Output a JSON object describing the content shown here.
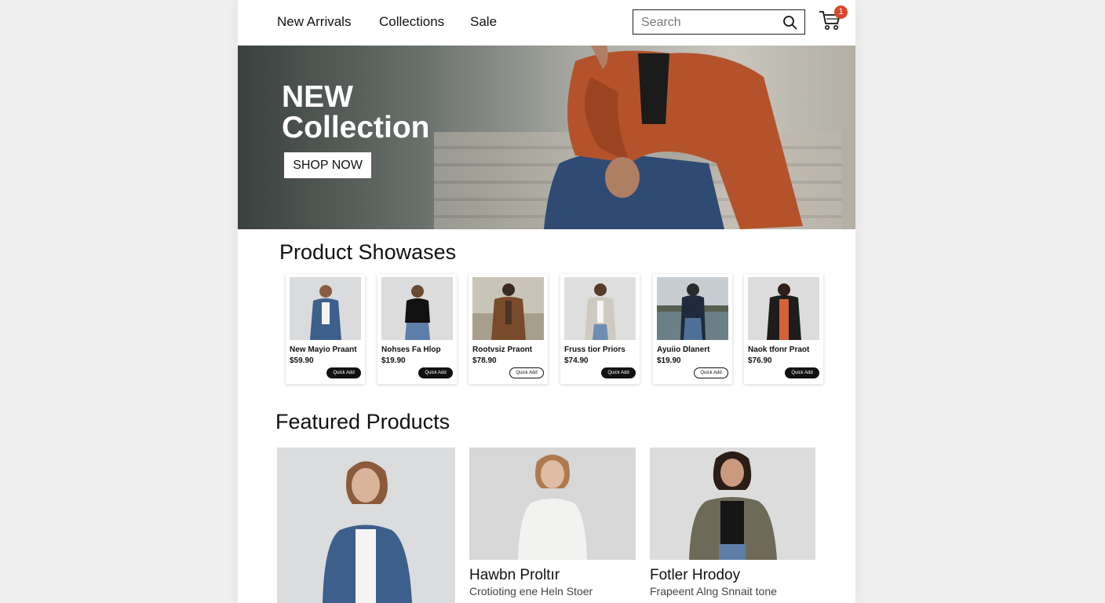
{
  "nav": {
    "links": [
      "New Arrivals",
      "Collections",
      "Sale"
    ],
    "search_placeholder": "Search",
    "cart_count": "1"
  },
  "hero": {
    "title_line1": "NEW",
    "title_line2": "Collection",
    "cta_label": "SHOP NOW"
  },
  "showcase": {
    "title": "Product Showases",
    "products": [
      {
        "name": "New Mayio Praant",
        "price": "$59.90",
        "button": "Quick Add",
        "button_style": "dark"
      },
      {
        "name": "Nohses Fa Hlop",
        "price": "$19.90",
        "button": "Quick Add",
        "button_style": "dark"
      },
      {
        "name": "Rootvsiz Praont",
        "price": "$78.90",
        "button": "Quick Add",
        "button_style": "light"
      },
      {
        "name": "Fruss tior Priors",
        "price": "$74.90",
        "button": "Quick Add",
        "button_style": "dark"
      },
      {
        "name": "Ayuiio Dlanert",
        "price": "$19.90",
        "button": "Quick Add",
        "button_style": "light"
      },
      {
        "name": "Naok tfonr Praot",
        "price": "$76.90",
        "button": "Quick Add",
        "button_style": "dark"
      }
    ]
  },
  "featured": {
    "title": "Featured Products",
    "products": [
      {
        "name": "",
        "desc": ""
      },
      {
        "name": "Hawbn Proltır",
        "desc": "Crotioting ene Heln Stoer"
      },
      {
        "name": "Fotler Hrodoy",
        "desc": "Frapeent Alng Snnait tone"
      }
    ]
  },
  "colors": {
    "accent_badge": "#d9472b",
    "jacket_rust": "#b4532b",
    "denim": "#3d5f8c",
    "text": "#111111"
  }
}
